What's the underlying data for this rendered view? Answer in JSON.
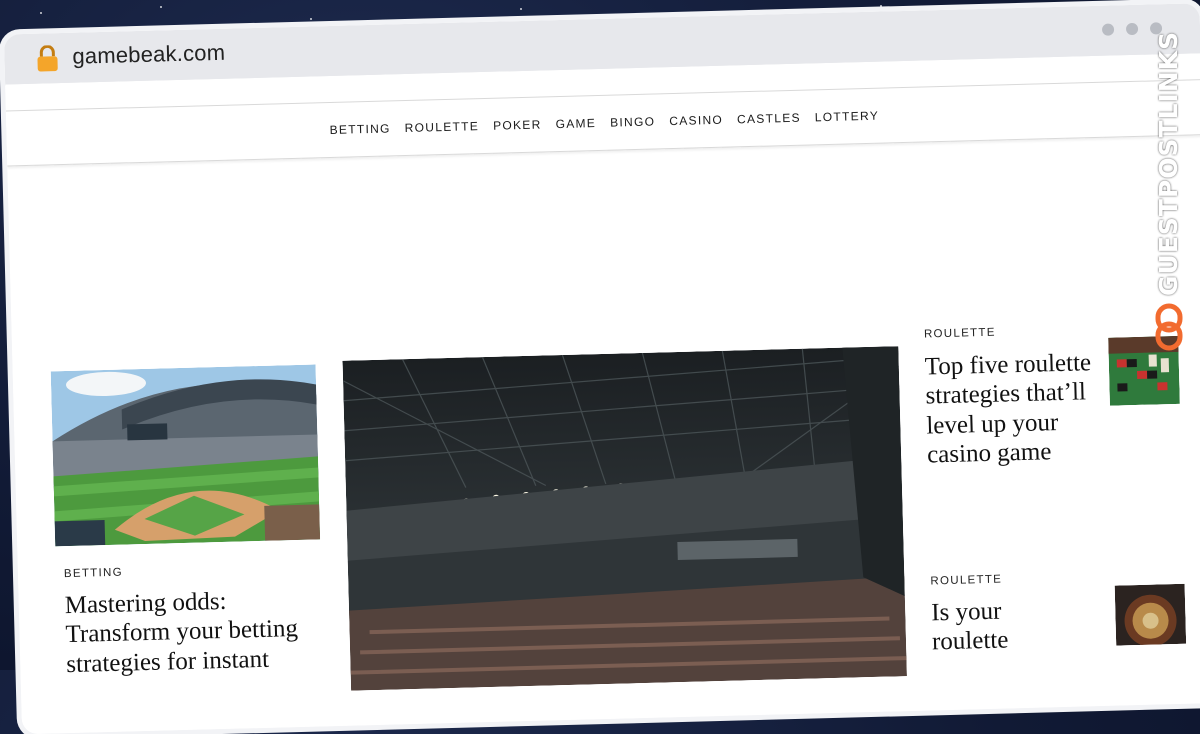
{
  "browser": {
    "url": "gamebeak.com",
    "lock_icon": "lock-icon",
    "accent": "#f4a52a"
  },
  "nav": {
    "items": [
      "BETTING",
      "ROULETTE",
      "POKER",
      "GAME",
      "BINGO",
      "CASINO",
      "CASTLES",
      "LOTTERY"
    ]
  },
  "articles": {
    "left": {
      "category": "BETTING",
      "title": "Mastering odds: Transform your betting strategies for instant"
    },
    "right1": {
      "category": "ROULETTE",
      "title": "Top five roulette strategies that’ll level up your casino game"
    },
    "right2": {
      "category": "ROULETTE",
      "title": "Is your roulette"
    }
  },
  "watermark": {
    "text": "GUESTPOSTLINKS",
    "icon": "chain-link-icon",
    "accent": "#f26b2f"
  }
}
